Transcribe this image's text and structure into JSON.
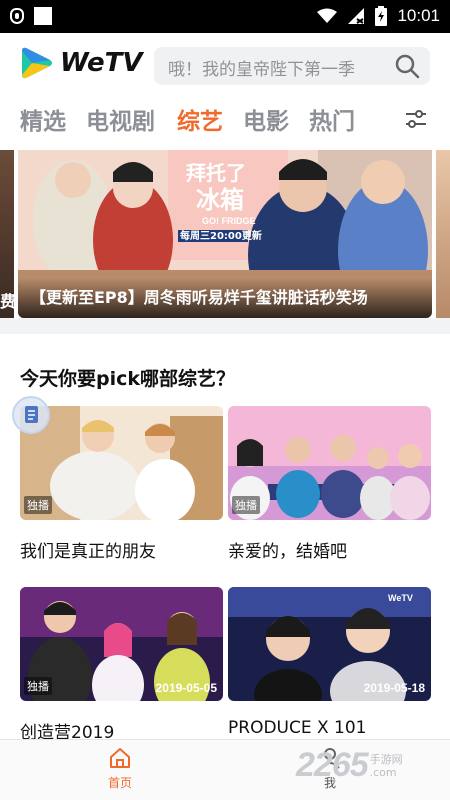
{
  "status_bar": {
    "time": "10:01"
  },
  "header": {
    "logo_text": "WeTV",
    "search_placeholder": "哦！我的皇帝陛下第一季"
  },
  "tabs": [
    {
      "label": "精选",
      "active": false
    },
    {
      "label": "电视剧",
      "active": false
    },
    {
      "label": "综艺",
      "active": true
    },
    {
      "label": "电影",
      "active": false
    },
    {
      "label": "热门",
      "active": false
    }
  ],
  "banner": {
    "caption": "【更新至EP8】周冬雨听易烊千玺讲脏话秒笑场",
    "left_peek_caption": "费",
    "image_text_1": "拜托了冰箱",
    "image_text_2": "GO! FRIDGE",
    "image_text_3": "每周三20:00更新"
  },
  "section": {
    "title": "今天你要pick哪部综艺？"
  },
  "cards": [
    {
      "title": "我们是真正的朋友",
      "badge": "独播",
      "date": ""
    },
    {
      "title": "亲爱的，结婚吧",
      "badge": "独播",
      "date": ""
    },
    {
      "title": "创造营2019",
      "badge": "独播",
      "date": "2019-05-05"
    },
    {
      "title": "PRODUCE X 101",
      "badge": "",
      "date": "2019-05-18"
    }
  ],
  "card4_overlay": "WeTV",
  "bottom_nav": {
    "home_label": "首页",
    "me_label": "我"
  },
  "watermark": {
    "number": "2265",
    "line1": "手游网",
    "line2": ".com"
  },
  "colors": {
    "accent": "#f06a2b",
    "tab_inactive": "#8c9096"
  }
}
